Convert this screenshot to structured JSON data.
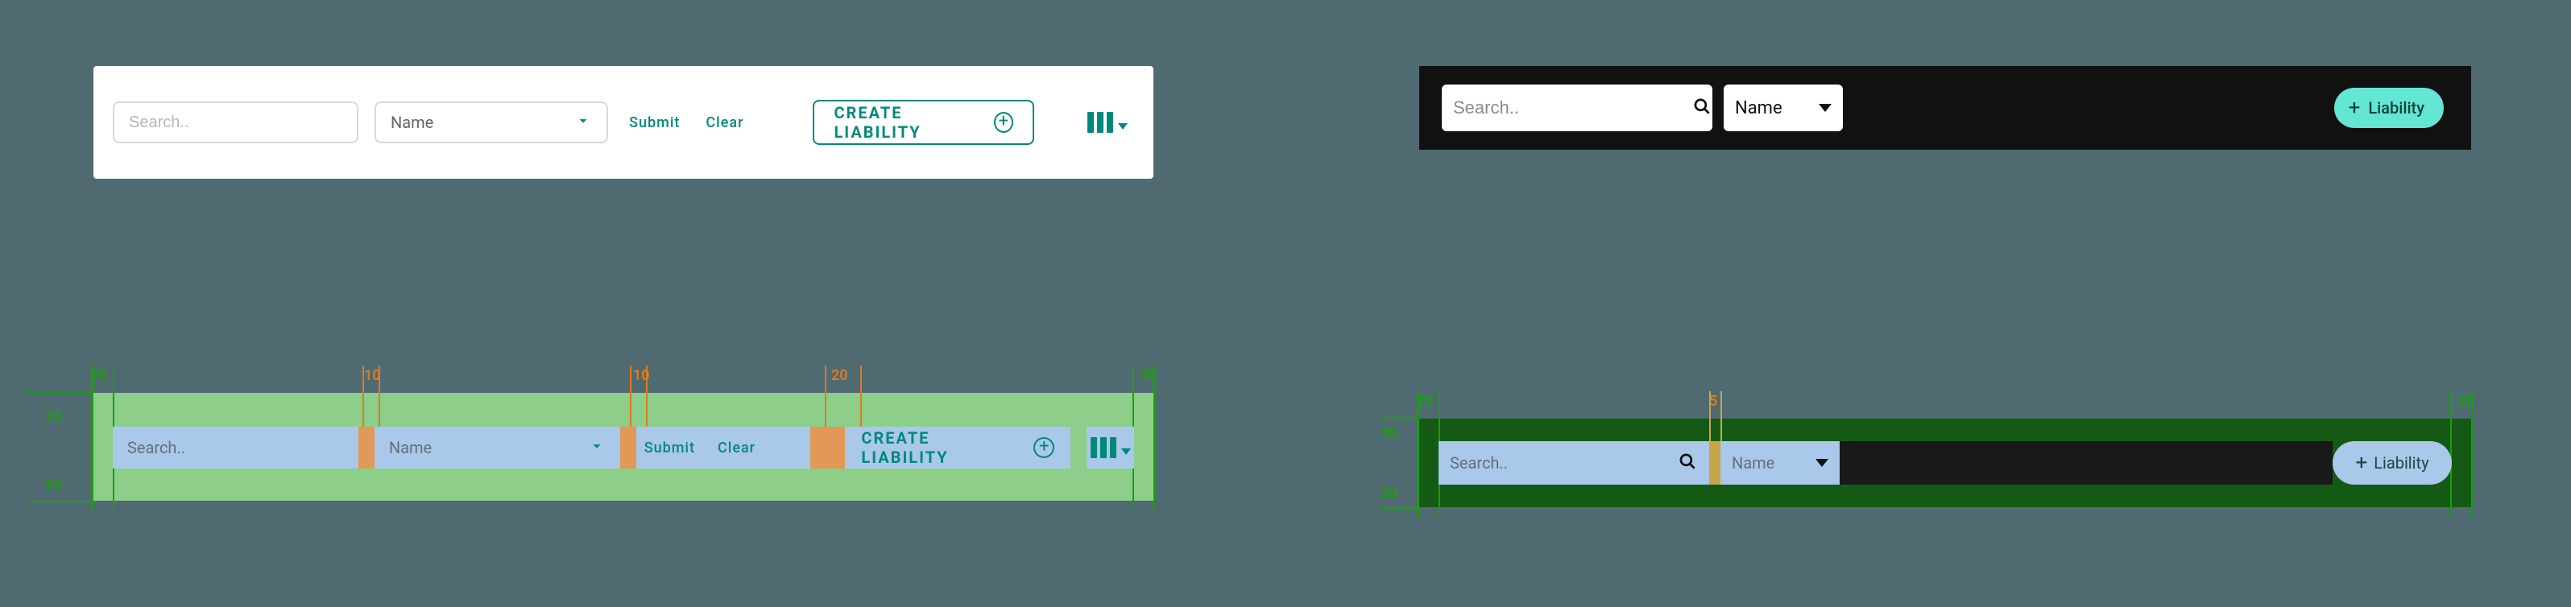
{
  "light": {
    "search_placeholder": "Search..",
    "select_label": "Name",
    "submit_label": "Submit",
    "clear_label": "Clear",
    "create_label": "CREATE LIABILITY"
  },
  "dark": {
    "search_placeholder": "Search..",
    "select_label": "Name",
    "add_label": "Liability"
  },
  "spec_left": {
    "pad_lr": "20",
    "pad_tb": "35",
    "gap1": "10",
    "gap2": "10",
    "gap3": "20"
  },
  "spec_right": {
    "pad_lr": "20",
    "pad_tb": "20",
    "gap1": "5"
  }
}
